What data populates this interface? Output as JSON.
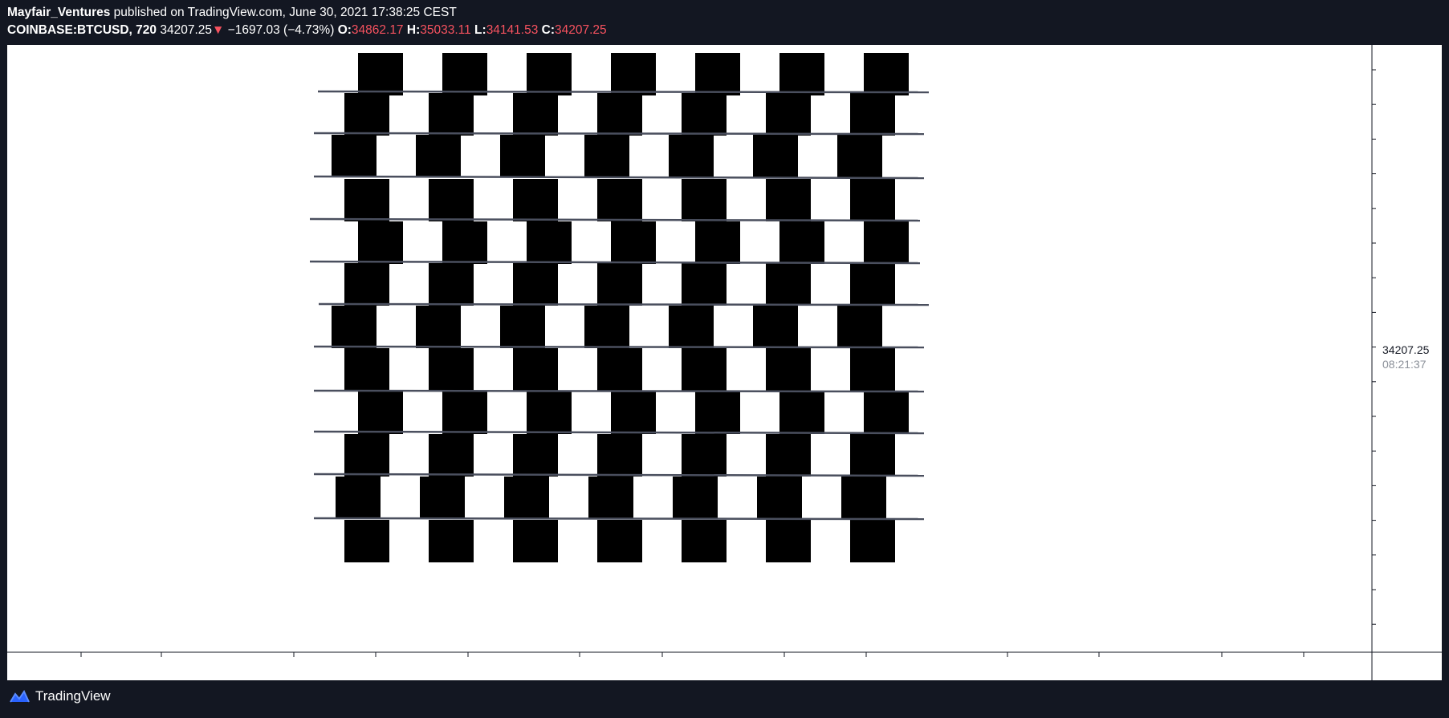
{
  "header": {
    "author": "Mayfair_Ventures",
    "published_text": " published on TradingView.com, June 30, 2021 17:38:25 CEST",
    "symbol": "COINBASE:BTCUSD, 720",
    "last_price": "34207.25",
    "change_arrow": "▼",
    "change": "−1697.03 (−4.73%)",
    "open_label": "O:",
    "open_value": "34862.17",
    "high_label": "H:",
    "high_value": "35033.11",
    "low_label": "L:",
    "low_value": "34141.53",
    "close_label": "C:",
    "close_value": "34207.25"
  },
  "price_scale": {
    "current_price": "34207.25",
    "countdown": "08:21:37"
  },
  "footer": {
    "brand": "TradingView"
  },
  "colors": {
    "background": "#131722",
    "down": "#f7525f",
    "pane": "#ffffff",
    "tile": "#000000",
    "grout": "#4a4f5e"
  }
}
